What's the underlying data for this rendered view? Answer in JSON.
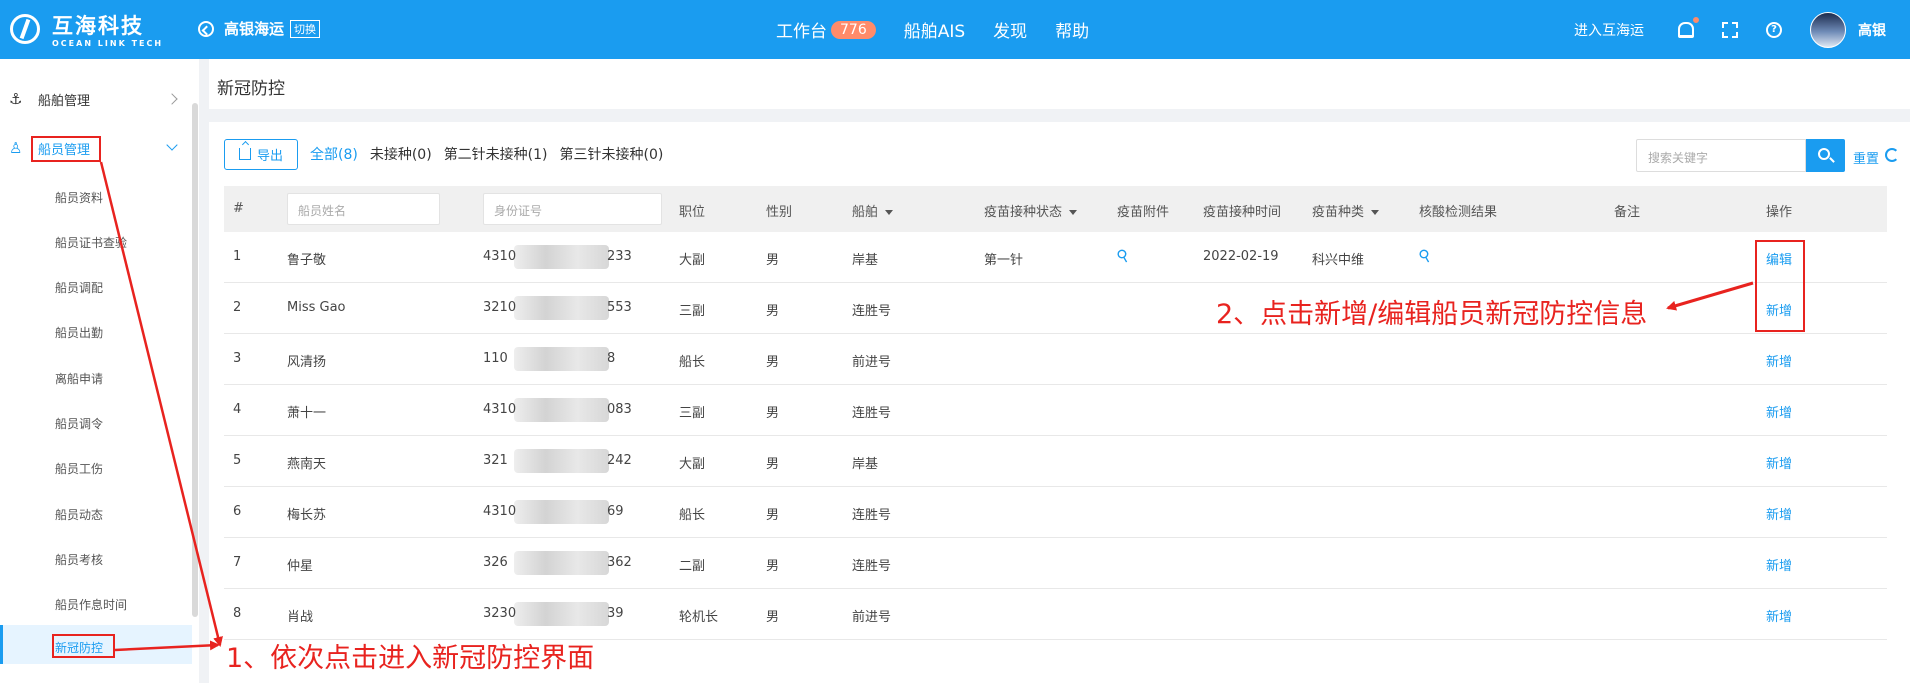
{
  "header": {
    "logo_cn": "互海科技",
    "logo_en": "OCEAN LINK TECH",
    "company": "高银海运",
    "switch_label": "切换",
    "nav": [
      {
        "label": "工作台",
        "badge": "776"
      },
      {
        "label": "船舶AIS"
      },
      {
        "label": "发现"
      },
      {
        "label": "帮助"
      }
    ],
    "enter_link": "进入互海运",
    "help_glyph": "?",
    "user_name": "高银"
  },
  "sidebar": {
    "groups": [
      {
        "label": "船舶管理",
        "icon": "anchor-icon"
      },
      {
        "label": "船员管理",
        "icon": "person-icon"
      }
    ],
    "items": [
      "船员资料",
      "船员证书查验",
      "船员调配",
      "船员出勤",
      "离船申请",
      "船员调令",
      "船员工伤",
      "船员动态",
      "船员考核",
      "船员作息时间",
      "新冠防控"
    ],
    "active_item": "新冠防控"
  },
  "page": {
    "title": "新冠防控"
  },
  "toolbar": {
    "export_label": "导出",
    "filters": [
      "全部(8)",
      "未接种(0)",
      "第二针未接种(1)",
      "第三针未接种(0)"
    ],
    "active_filter": "全部(8)",
    "search_placeholder": "搜索关键字",
    "reset_label": "重置"
  },
  "table": {
    "columns": {
      "index": "#",
      "name_placeholder": "船员姓名",
      "id_placeholder": "身份证号",
      "position": "职位",
      "gender": "性别",
      "vessel": "船舶",
      "vaccine_status": "疫苗接种状态",
      "attachment": "疫苗附件",
      "vaccine_time": "疫苗接种时间",
      "vaccine_type": "疫苗种类",
      "nucleic": "核酸检测结果",
      "remark": "备注",
      "action": "操作"
    },
    "rows": [
      {
        "no": "1",
        "name": "鲁子敬",
        "id_prefix": "4310",
        "id_suffix": "233",
        "position": "大副",
        "gender": "男",
        "vessel": "岸基",
        "status": "第一针",
        "has_attachment": true,
        "time": "2022-02-19",
        "type": "科兴中维",
        "has_nucleic": true,
        "action": "编辑"
      },
      {
        "no": "2",
        "name": "Miss Gao",
        "id_prefix": "3210",
        "id_suffix": "553",
        "position": "三副",
        "gender": "男",
        "vessel": "连胜号",
        "status": "",
        "has_attachment": false,
        "time": "",
        "type": "",
        "has_nucleic": false,
        "action": "新增"
      },
      {
        "no": "3",
        "name": "风清扬",
        "id_prefix": "110",
        "id_suffix": "8",
        "position": "船长",
        "gender": "男",
        "vessel": "前进号",
        "status": "",
        "has_attachment": false,
        "time": "",
        "type": "",
        "has_nucleic": false,
        "action": "新增"
      },
      {
        "no": "4",
        "name": "萧十一",
        "id_prefix": "4310",
        "id_suffix": "083",
        "position": "三副",
        "gender": "男",
        "vessel": "连胜号",
        "status": "",
        "has_attachment": false,
        "time": "",
        "type": "",
        "has_nucleic": false,
        "action": "新增"
      },
      {
        "no": "5",
        "name": "燕南天",
        "id_prefix": "321",
        "id_suffix": "242",
        "position": "大副",
        "gender": "男",
        "vessel": "岸基",
        "status": "",
        "has_attachment": false,
        "time": "",
        "type": "",
        "has_nucleic": false,
        "action": "新增"
      },
      {
        "no": "6",
        "name": "梅长苏",
        "id_prefix": "4310",
        "id_suffix": "69",
        "position": "船长",
        "gender": "男",
        "vessel": "连胜号",
        "status": "",
        "has_attachment": false,
        "time": "",
        "type": "",
        "has_nucleic": false,
        "action": "新增"
      },
      {
        "no": "7",
        "name": "仲星",
        "id_prefix": "326",
        "id_suffix": "362",
        "position": "二副",
        "gender": "男",
        "vessel": "连胜号",
        "status": "",
        "has_attachment": false,
        "time": "",
        "type": "",
        "has_nucleic": false,
        "action": "新增"
      },
      {
        "no": "8",
        "name": "肖战",
        "id_prefix": "3230",
        "id_suffix": "39",
        "position": "轮机长",
        "gender": "男",
        "vessel": "前进号",
        "status": "",
        "has_attachment": false,
        "time": "",
        "type": "",
        "has_nucleic": false,
        "action": "新增"
      }
    ]
  },
  "annotations": {
    "step1": "1、依次点击进入新冠防控界面",
    "step2": "2、点击新增/编辑船员新冠防控信息",
    "color": "#e8231f"
  },
  "colors": {
    "primary": "#1a9cf0",
    "badge": "#ff8b6a"
  }
}
